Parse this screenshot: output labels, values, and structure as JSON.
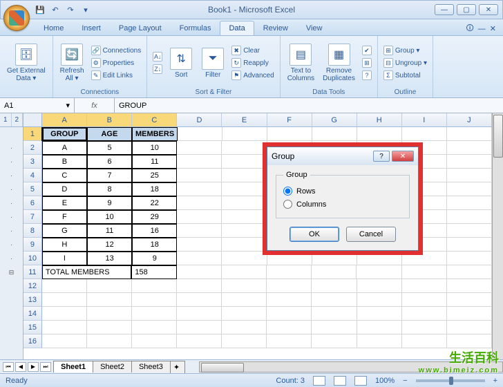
{
  "window": {
    "title": "Book1 - Microsoft Excel"
  },
  "tabs": {
    "items": [
      "Home",
      "Insert",
      "Page Layout",
      "Formulas",
      "Data",
      "Review",
      "View"
    ],
    "active": "Data"
  },
  "ribbon": {
    "get_external": "Get External\nData ▾",
    "refresh": "Refresh\nAll ▾",
    "connections": "Connections",
    "properties": "Properties",
    "edit_links": "Edit Links",
    "connections_group": "Connections",
    "sort_az": "A→Z",
    "sort_za": "Z→A",
    "sort": "Sort",
    "filter": "Filter",
    "clear": "Clear",
    "reapply": "Reapply",
    "advanced": "Advanced",
    "sort_filter_group": "Sort & Filter",
    "text_cols": "Text to\nColumns",
    "remove_dup": "Remove\nDuplicates",
    "data_tools_group": "Data Tools",
    "group_btn": "Group ▾",
    "ungroup_btn": "Ungroup ▾",
    "subtotal": "Subtotal",
    "outline_group": "Outline"
  },
  "namebox": "A1",
  "fx_value": "GROUP",
  "columns": [
    "A",
    "B",
    "C",
    "D",
    "E",
    "F",
    "G",
    "H",
    "I",
    "J"
  ],
  "data_rows": [
    {
      "n": 1,
      "a": "GROUP",
      "b": "AGE",
      "c": "MEMBERS",
      "hdr": true
    },
    {
      "n": 2,
      "a": "A",
      "b": "5",
      "c": "10"
    },
    {
      "n": 3,
      "a": "B",
      "b": "6",
      "c": "11"
    },
    {
      "n": 4,
      "a": "C",
      "b": "7",
      "c": "25"
    },
    {
      "n": 5,
      "a": "D",
      "b": "8",
      "c": "18"
    },
    {
      "n": 6,
      "a": "E",
      "b": "9",
      "c": "22"
    },
    {
      "n": 7,
      "a": "F",
      "b": "10",
      "c": "29"
    },
    {
      "n": 8,
      "a": "G",
      "b": "11",
      "c": "16"
    },
    {
      "n": 9,
      "a": "H",
      "b": "12",
      "c": "18"
    },
    {
      "n": 10,
      "a": "I",
      "b": "13",
      "c": "9"
    },
    {
      "n": 11,
      "a": "TOTAL MEMBERS",
      "b": "",
      "c": "158",
      "total": true
    }
  ],
  "empty_rows": [
    12,
    13,
    14,
    15,
    16
  ],
  "outline_levels": [
    "1",
    "2"
  ],
  "sheets": [
    "Sheet1",
    "Sheet2",
    "Sheet3"
  ],
  "status": {
    "ready": "Ready",
    "count": "Count: 3",
    "zoom": "100%"
  },
  "dialog": {
    "title": "Group",
    "legend": "Group",
    "rows": "Rows",
    "columns": "Columns",
    "ok": "OK",
    "cancel": "Cancel"
  },
  "watermark": {
    "main": "生活百科",
    "sub": "www.bimeiz.com"
  }
}
